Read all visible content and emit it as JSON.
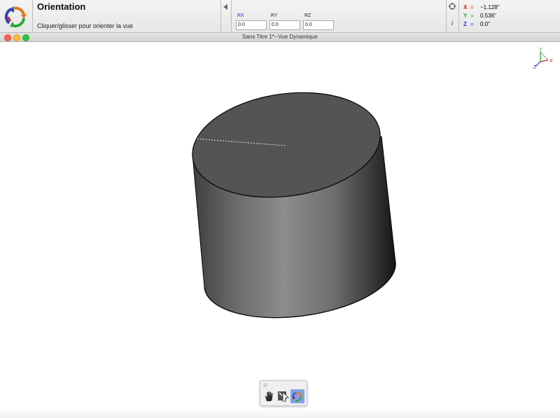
{
  "tool": {
    "title": "Orientation",
    "hint": "Cliquer/glisser pour orienter la vue",
    "icon": "orbit-rotate-icon"
  },
  "rotation": {
    "rx_label": "RX",
    "rx_value": "0.0",
    "ry_label": "RY",
    "ry_value": "0.0",
    "rz_label": "RZ",
    "rz_value": "0.0"
  },
  "coordinates": {
    "x_label": "X",
    "x_value": "~1.128\"",
    "y_label": "Y",
    "y_value": "0.536\"",
    "z_label": "Z",
    "z_value": "0.0\""
  },
  "side_icons": [
    "snap-target-icon",
    "info-icon"
  ],
  "info_glyph": "i",
  "window": {
    "title": "Sans Titre 1*--Vue Dynamique"
  },
  "axis_triad": {
    "x": "X",
    "y": "Y",
    "z": "Z"
  },
  "palette": {
    "tools": [
      "pan-hand-icon",
      "zoom-icon",
      "orbit-rotate-icon"
    ],
    "active_tool": "orbit-rotate-icon"
  },
  "colors": {
    "x_axis": "#d42020",
    "y_axis": "#1ea51e",
    "z_axis": "#2530d8",
    "active_field_label": "#2b35d6"
  }
}
